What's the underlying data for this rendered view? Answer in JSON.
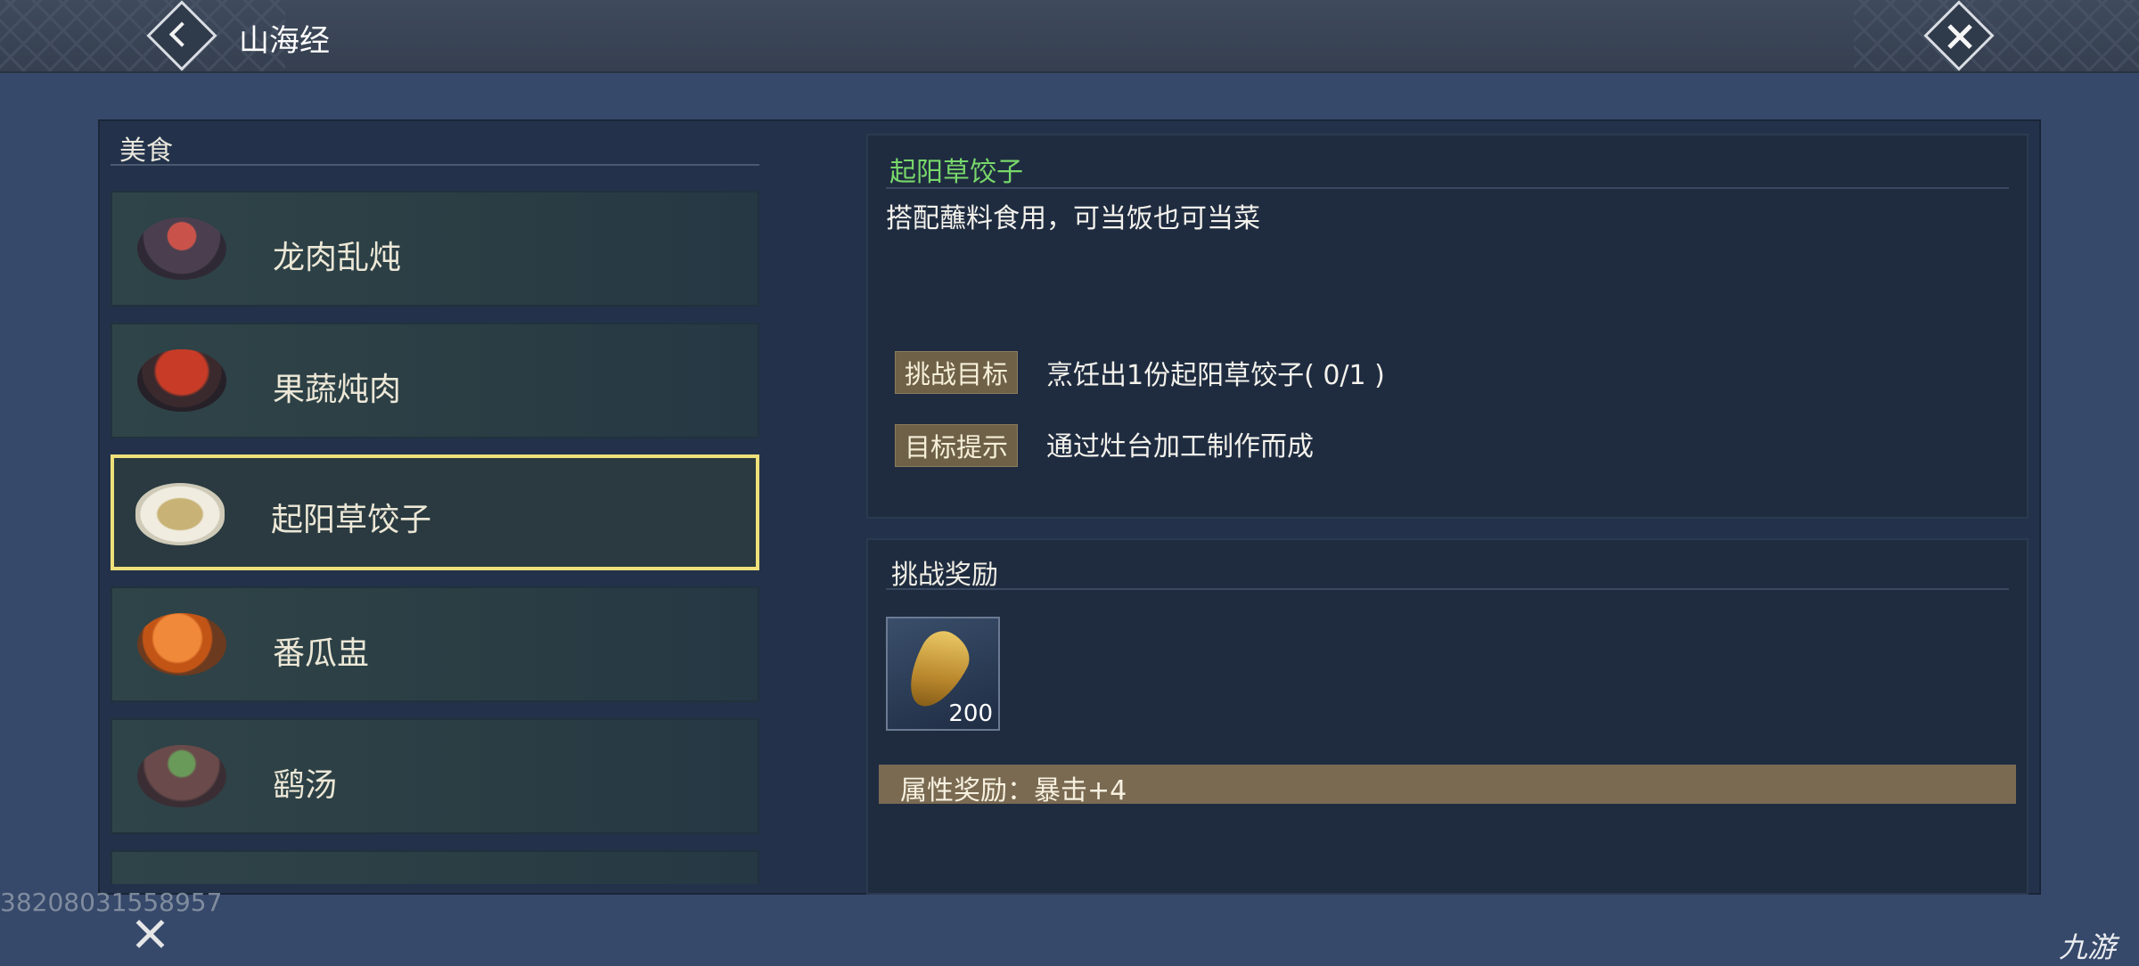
{
  "header": {
    "title": "山海经"
  },
  "category": {
    "label": "美食"
  },
  "dishes": [
    {
      "name": "龙肉乱炖",
      "icon": "stew-bowl-icon"
    },
    {
      "name": "果蔬炖肉",
      "icon": "meat-bowl-icon"
    },
    {
      "name": "起阳草饺子",
      "icon": "dumpling-plate-icon",
      "selected": true
    },
    {
      "name": "番瓜盅",
      "icon": "pumpkin-dish-icon"
    },
    {
      "name": "鹞汤",
      "icon": "soup-pot-icon"
    }
  ],
  "detail": {
    "title": "起阳草饺子",
    "description": "搭配蘸料食用，可当饭也可当菜",
    "goal_label": "挑战目标",
    "goal_text": "烹饪出1份起阳草饺子( 0/1 )",
    "hint_label": "目标提示",
    "hint_text": "通过灶台加工制作而成"
  },
  "reward": {
    "title": "挑战奖励",
    "item_count": "200",
    "attribute": "属性奖励：暴击+4"
  },
  "footer": {
    "player_id": "38208031558957",
    "logo": "九游"
  },
  "colors": {
    "accent_green": "#78d86a",
    "selection_yellow": "#efe07a",
    "tag_brown": "#6e6148"
  }
}
